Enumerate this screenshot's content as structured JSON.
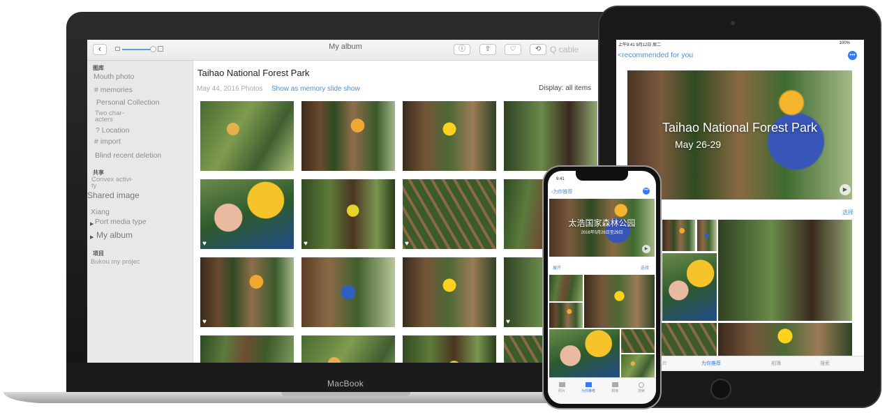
{
  "macbook": {
    "brand": "MacBook",
    "toolbar": {
      "window_title": "My album",
      "back_glyph": "‹",
      "info_glyph": "ⓘ",
      "share_glyph": "⇧",
      "favorite_glyph": "♡",
      "rotate_glyph": "⟲",
      "search_text": "Q cable"
    },
    "sidebar": {
      "library_header": "图库",
      "library_items": [
        "Mouth photo",
        "# memories",
        "Personal Collection",
        "Two char-",
        "acters",
        "? Location",
        "# import",
        "Blind recent deletion"
      ],
      "shared_header": "共享",
      "shared_items": [
        "Convex activi-",
        "ty",
        "Shared image",
        "Xiang"
      ],
      "albums": [
        "Port media type",
        "My album"
      ],
      "projects_header": "项目",
      "projects_items": [
        "Bukou my projec"
      ]
    },
    "content": {
      "title": "Taihao National Forest Park",
      "date_count": "May 44, 2016 Photos",
      "slideshow_link": "Show as memory slide show",
      "display_label": "Display: all items",
      "heart_glyph": "♥"
    }
  },
  "ipad": {
    "nav_back": "<recommended for you",
    "more_glyph": "•••",
    "status": {
      "time": "上午9:41  9月12日 周二",
      "battery": "100%"
    },
    "hero_title": "Taihao National Forest Park",
    "hero_date": "May 26-29",
    "play_glyph": "▶",
    "select_label": "选择",
    "tabs": [
      "片",
      "为你推荐",
      "相簿",
      "搜索"
    ]
  },
  "iphone": {
    "time": "9:41",
    "nav_back": "‹为你推荐",
    "more_glyph": "•••",
    "hero_title": "太浩国家森林公园",
    "hero_date": "2016年5月26日至29日",
    "play_glyph": "▶",
    "expand_label": "展开",
    "select_label": "选择",
    "tabs": [
      "照片",
      "为你推荐",
      "相簿",
      "搜索"
    ]
  },
  "colors": {
    "accent": "#4a90d9",
    "ios_blue": "#2f7cf6",
    "helmet_yellow": "#f5b52c"
  }
}
